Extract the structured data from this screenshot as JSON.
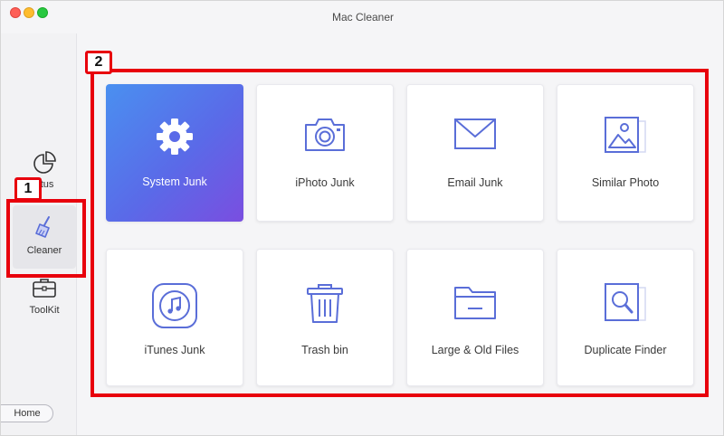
{
  "window": {
    "title": "Mac Cleaner"
  },
  "sidebar": {
    "items": [
      {
        "label": "Status",
        "partial_label": "atus",
        "icon": "pie-chart-icon"
      },
      {
        "label": "Cleaner",
        "icon": "broom-icon"
      },
      {
        "label": "ToolKit",
        "icon": "toolbox-icon"
      }
    ],
    "home_label": "Home"
  },
  "annotations": {
    "badge1": "1",
    "badge2": "2"
  },
  "cards": [
    {
      "label": "System Junk",
      "icon": "gear-icon",
      "active": true
    },
    {
      "label": "iPhoto Junk",
      "icon": "camera-icon"
    },
    {
      "label": "Email Junk",
      "icon": "envelope-icon"
    },
    {
      "label": "Similar Photo",
      "icon": "photo-icon"
    },
    {
      "label": "iTunes Junk",
      "icon": "music-icon"
    },
    {
      "label": "Trash bin",
      "icon": "trash-icon"
    },
    {
      "label": "Large & Old Files",
      "icon": "folder-icon"
    },
    {
      "label": "Duplicate Finder",
      "icon": "magnifier-icon"
    }
  ],
  "colors": {
    "accent": "#5b6ce8",
    "icon_stroke": "#5a6ed8",
    "annotation_red": "#e8000c"
  }
}
